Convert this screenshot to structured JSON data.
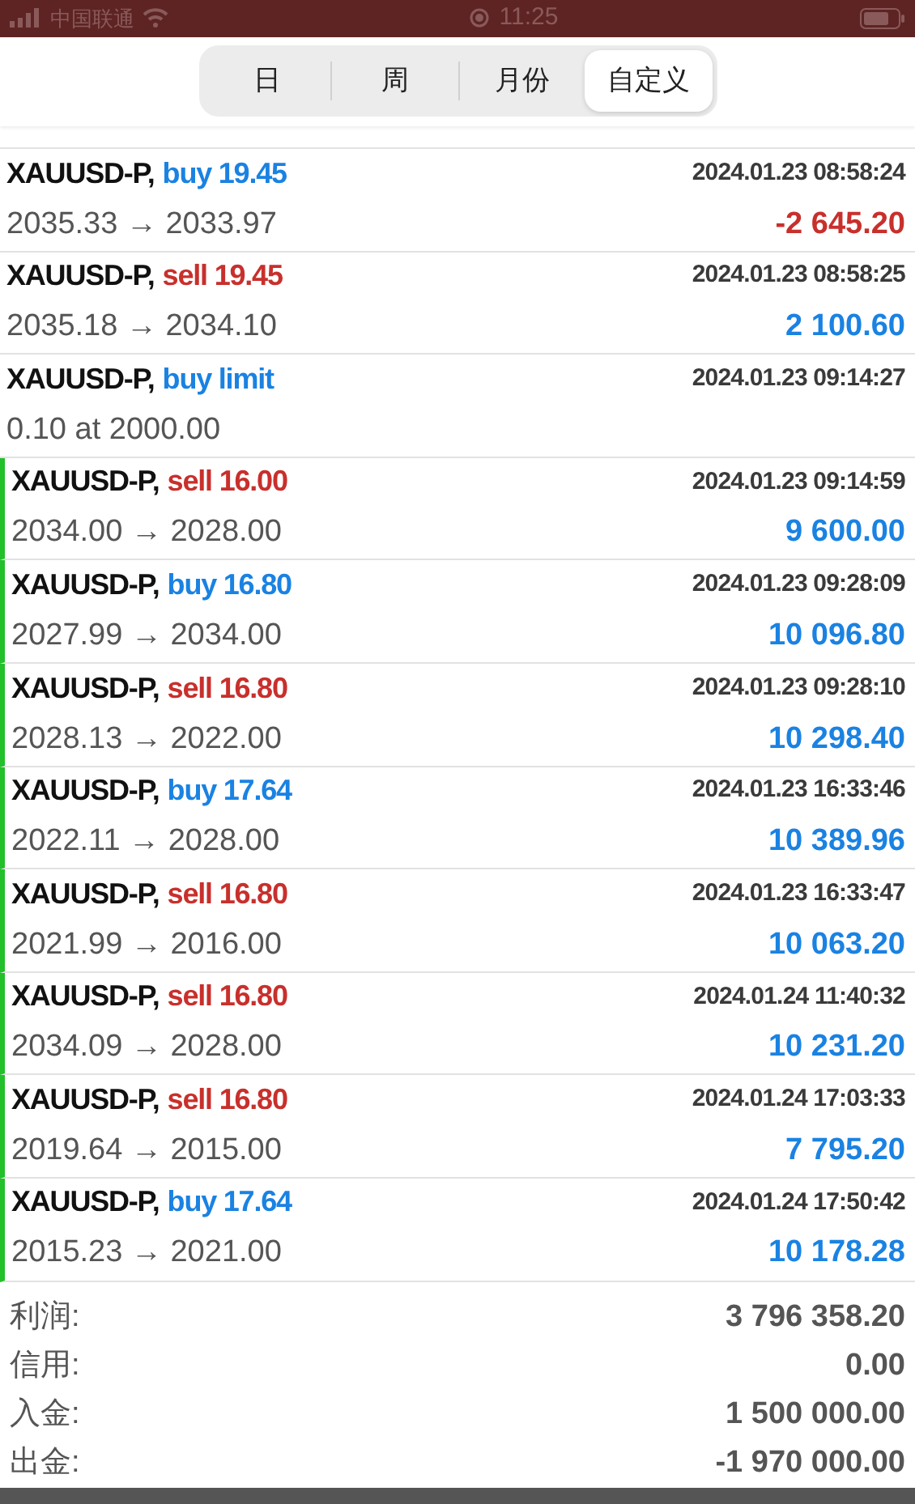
{
  "status_bar": {
    "carrier": "中国联通",
    "time": "11:25"
  },
  "period_tabs": [
    {
      "label": "日",
      "selected": false
    },
    {
      "label": "周",
      "selected": false
    },
    {
      "label": "月份",
      "selected": false
    },
    {
      "label": "自定义",
      "selected": true
    }
  ],
  "trades": [
    {
      "kind": "deal",
      "symbol": "XAUUSD-P,",
      "color": "#1a82e2",
      "action": "buy 19.45",
      "time": "2024.01.23 08:58:24",
      "detail": "2035.33 → 2033.97",
      "profit": "-2 645.20",
      "loss": true,
      "flagged": false
    },
    {
      "kind": "deal",
      "symbol": "XAUUSD-P,",
      "color": "#c8302c",
      "action": "sell 19.45",
      "time": "2024.01.23 08:58:25",
      "detail": "2035.18 → 2034.10",
      "profit": "2 100.60",
      "loss": false,
      "flagged": false
    },
    {
      "kind": "order",
      "symbol": "XAUUSD-P,",
      "color": "#1a82e2",
      "action": "buy limit",
      "time": "2024.01.23 09:14:27",
      "detail": "0.10 at 2000.00",
      "flagged": false
    },
    {
      "kind": "deal",
      "symbol": "XAUUSD-P,",
      "color": "#c8302c",
      "action": "sell 16.00",
      "time": "2024.01.23 09:14:59",
      "detail": "2034.00 → 2028.00",
      "profit": "9 600.00",
      "loss": false,
      "flagged": true
    },
    {
      "kind": "deal",
      "symbol": "XAUUSD-P,",
      "color": "#1a82e2",
      "action": "buy 16.80",
      "time": "2024.01.23 09:28:09",
      "detail": "2027.99 → 2034.00",
      "profit": "10 096.80",
      "loss": false,
      "flagged": true
    },
    {
      "kind": "deal",
      "symbol": "XAUUSD-P,",
      "color": "#c8302c",
      "action": "sell 16.80",
      "time": "2024.01.23 09:28:10",
      "detail": "2028.13 → 2022.00",
      "profit": "10 298.40",
      "loss": false,
      "flagged": true
    },
    {
      "kind": "deal",
      "symbol": "XAUUSD-P,",
      "color": "#1a82e2",
      "action": "buy 17.64",
      "time": "2024.01.23 16:33:46",
      "detail": "2022.11 → 2028.00",
      "profit": "10 389.96",
      "loss": false,
      "flagged": true
    },
    {
      "kind": "deal",
      "symbol": "XAUUSD-P,",
      "color": "#c8302c",
      "action": "sell 16.80",
      "time": "2024.01.23 16:33:47",
      "detail": "2021.99 → 2016.00",
      "profit": "10 063.20",
      "loss": false,
      "flagged": true
    },
    {
      "kind": "deal",
      "symbol": "XAUUSD-P,",
      "color": "#c8302c",
      "action": "sell 16.80",
      "time": "2024.01.24 11:40:32",
      "detail": "2034.09 → 2028.00",
      "profit": "10 231.20",
      "loss": false,
      "flagged": true
    },
    {
      "kind": "deal",
      "symbol": "XAUUSD-P,",
      "color": "#c8302c",
      "action": "sell 16.80",
      "time": "2024.01.24 17:03:33",
      "detail": "2019.64 → 2015.00",
      "profit": "7 795.20",
      "loss": false,
      "flagged": true
    },
    {
      "kind": "deal",
      "symbol": "XAUUSD-P,",
      "color": "#1a82e2",
      "action": "buy 17.64",
      "time": "2024.01.24 17:50:42",
      "detail": "2015.23 → 2021.00",
      "profit": "10 178.28",
      "loss": false,
      "flagged": true
    }
  ],
  "summary": [
    {
      "label": "利润:",
      "value": "3 796 358.20"
    },
    {
      "label": "信用:",
      "value": "0.00"
    },
    {
      "label": "入金:",
      "value": "1 500 000.00"
    },
    {
      "label": "出金:",
      "value": "-1 970 000.00"
    }
  ]
}
